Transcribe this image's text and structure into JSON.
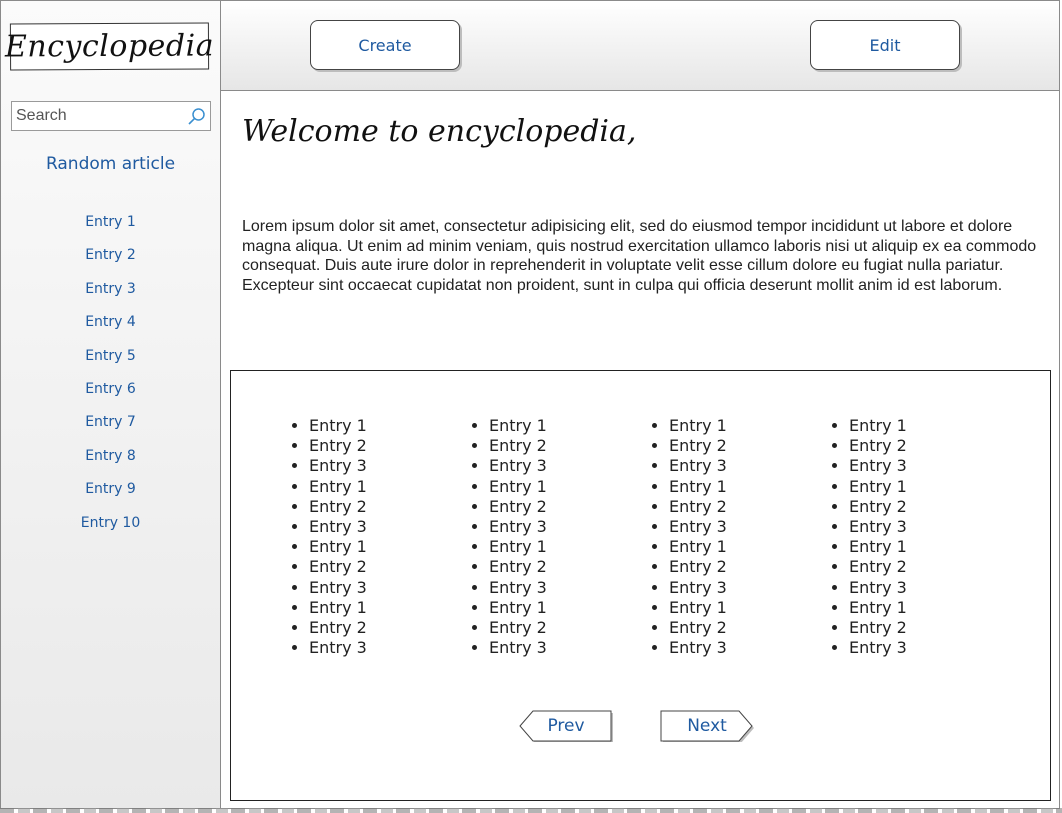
{
  "sidebar": {
    "logo": "Encyclopedia",
    "search_placeholder": "Search",
    "random_article": "Random article",
    "entries": [
      "Entry 1",
      "Entry 2",
      "Entry 3",
      "Entry 4",
      "Entry 5",
      "Entry 6",
      "Entry 7",
      "Entry 8",
      "Entry 9",
      "Entry 10"
    ]
  },
  "toolbar": {
    "create_label": "Create",
    "edit_label": "Edit"
  },
  "main": {
    "heading": "Welcome to encyclopedia,",
    "body": "Lorem ipsum dolor sit amet, consectetur adipisicing elit, sed do eiusmod tempor incididunt ut labore et dolore magna aliqua. Ut enim ad minim veniam, quis nostrud exercitation ullamco laboris nisi ut aliquip ex ea commodo consequat. Duis aute irure dolor in reprehenderit in voluptate velit esse cillum dolore eu fugiat nulla pariatur. Excepteur sint occaecat cupidatat non proident, sunt in culpa qui officia deserunt mollit anim id est laborum."
  },
  "list_panel": {
    "columns": [
      [
        "Entry 1",
        "Entry 2",
        "Entry 3",
        "Entry 1",
        "Entry 2",
        "Entry 3",
        "Entry 1",
        "Entry 2",
        "Entry 3",
        "Entry 1",
        "Entry 2",
        "Entry 3"
      ],
      [
        "Entry 1",
        "Entry 2",
        "Entry 3",
        "Entry 1",
        "Entry 2",
        "Entry 3",
        "Entry 1",
        "Entry 2",
        "Entry 3",
        "Entry 1",
        "Entry 2",
        "Entry 3"
      ],
      [
        "Entry 1",
        "Entry 2",
        "Entry 3",
        "Entry 1",
        "Entry 2",
        "Entry 3",
        "Entry 1",
        "Entry 2",
        "Entry 3",
        "Entry 1",
        "Entry 2",
        "Entry 3"
      ],
      [
        "Entry 1",
        "Entry 2",
        "Entry 3",
        "Entry 1",
        "Entry 2",
        "Entry 3",
        "Entry 1",
        "Entry 2",
        "Entry 3",
        "Entry 1",
        "Entry 2",
        "Entry 3"
      ]
    ],
    "prev_label": "Prev",
    "next_label": "Next"
  },
  "icons": {
    "search": "search-icon"
  },
  "colors": {
    "link": "#1f5aa0",
    "border": "#8a8a8a"
  }
}
